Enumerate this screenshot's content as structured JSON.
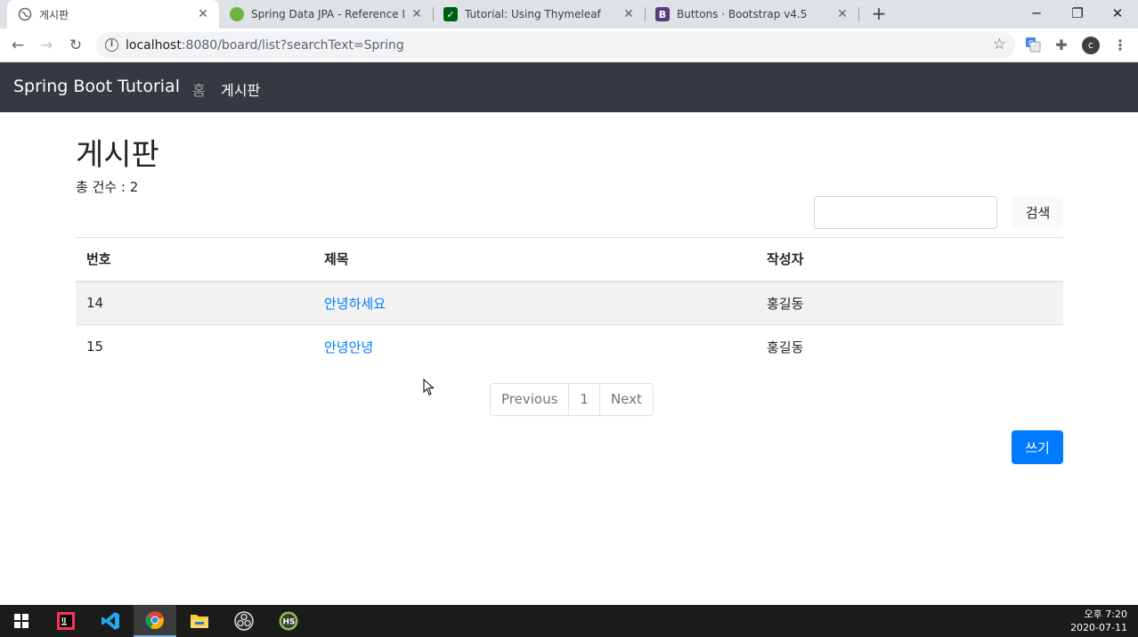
{
  "browser": {
    "tabs": [
      {
        "title": "게시판",
        "icon": "globe-icon"
      },
      {
        "title": "Spring Data JPA - Reference Do",
        "icon": "spring-icon"
      },
      {
        "title": "Tutorial: Using Thymeleaf",
        "icon": "thymeleaf-icon"
      },
      {
        "title": "Buttons · Bootstrap v4.5",
        "icon": "bootstrap-icon"
      }
    ],
    "url_host": "localhost",
    "url_rest": ":8080/board/list?searchText=Spring",
    "profile_initial": "c"
  },
  "navbar": {
    "brand": "Spring Boot Tutorial",
    "links": [
      {
        "label": "홈",
        "active": false
      },
      {
        "label": "게시판",
        "active": true
      }
    ]
  },
  "page": {
    "title": "게시판",
    "count_text": "총 건수 : 2",
    "search_value": "",
    "search_button": "검색",
    "write_button": "쓰기"
  },
  "table": {
    "headers": [
      "번호",
      "제목",
      "작성자"
    ],
    "rows": [
      {
        "id": "14",
        "title": "안녕하세요",
        "author": "홍길동"
      },
      {
        "id": "15",
        "title": "안녕안녕",
        "author": "홍길동"
      }
    ]
  },
  "pagination": {
    "previous": "Previous",
    "page": "1",
    "next": "Next"
  },
  "taskbar": {
    "time": "오후 7:20",
    "date": "2020-07-11"
  },
  "colors": {
    "primary": "#007bff",
    "navbar": "#343a40"
  }
}
